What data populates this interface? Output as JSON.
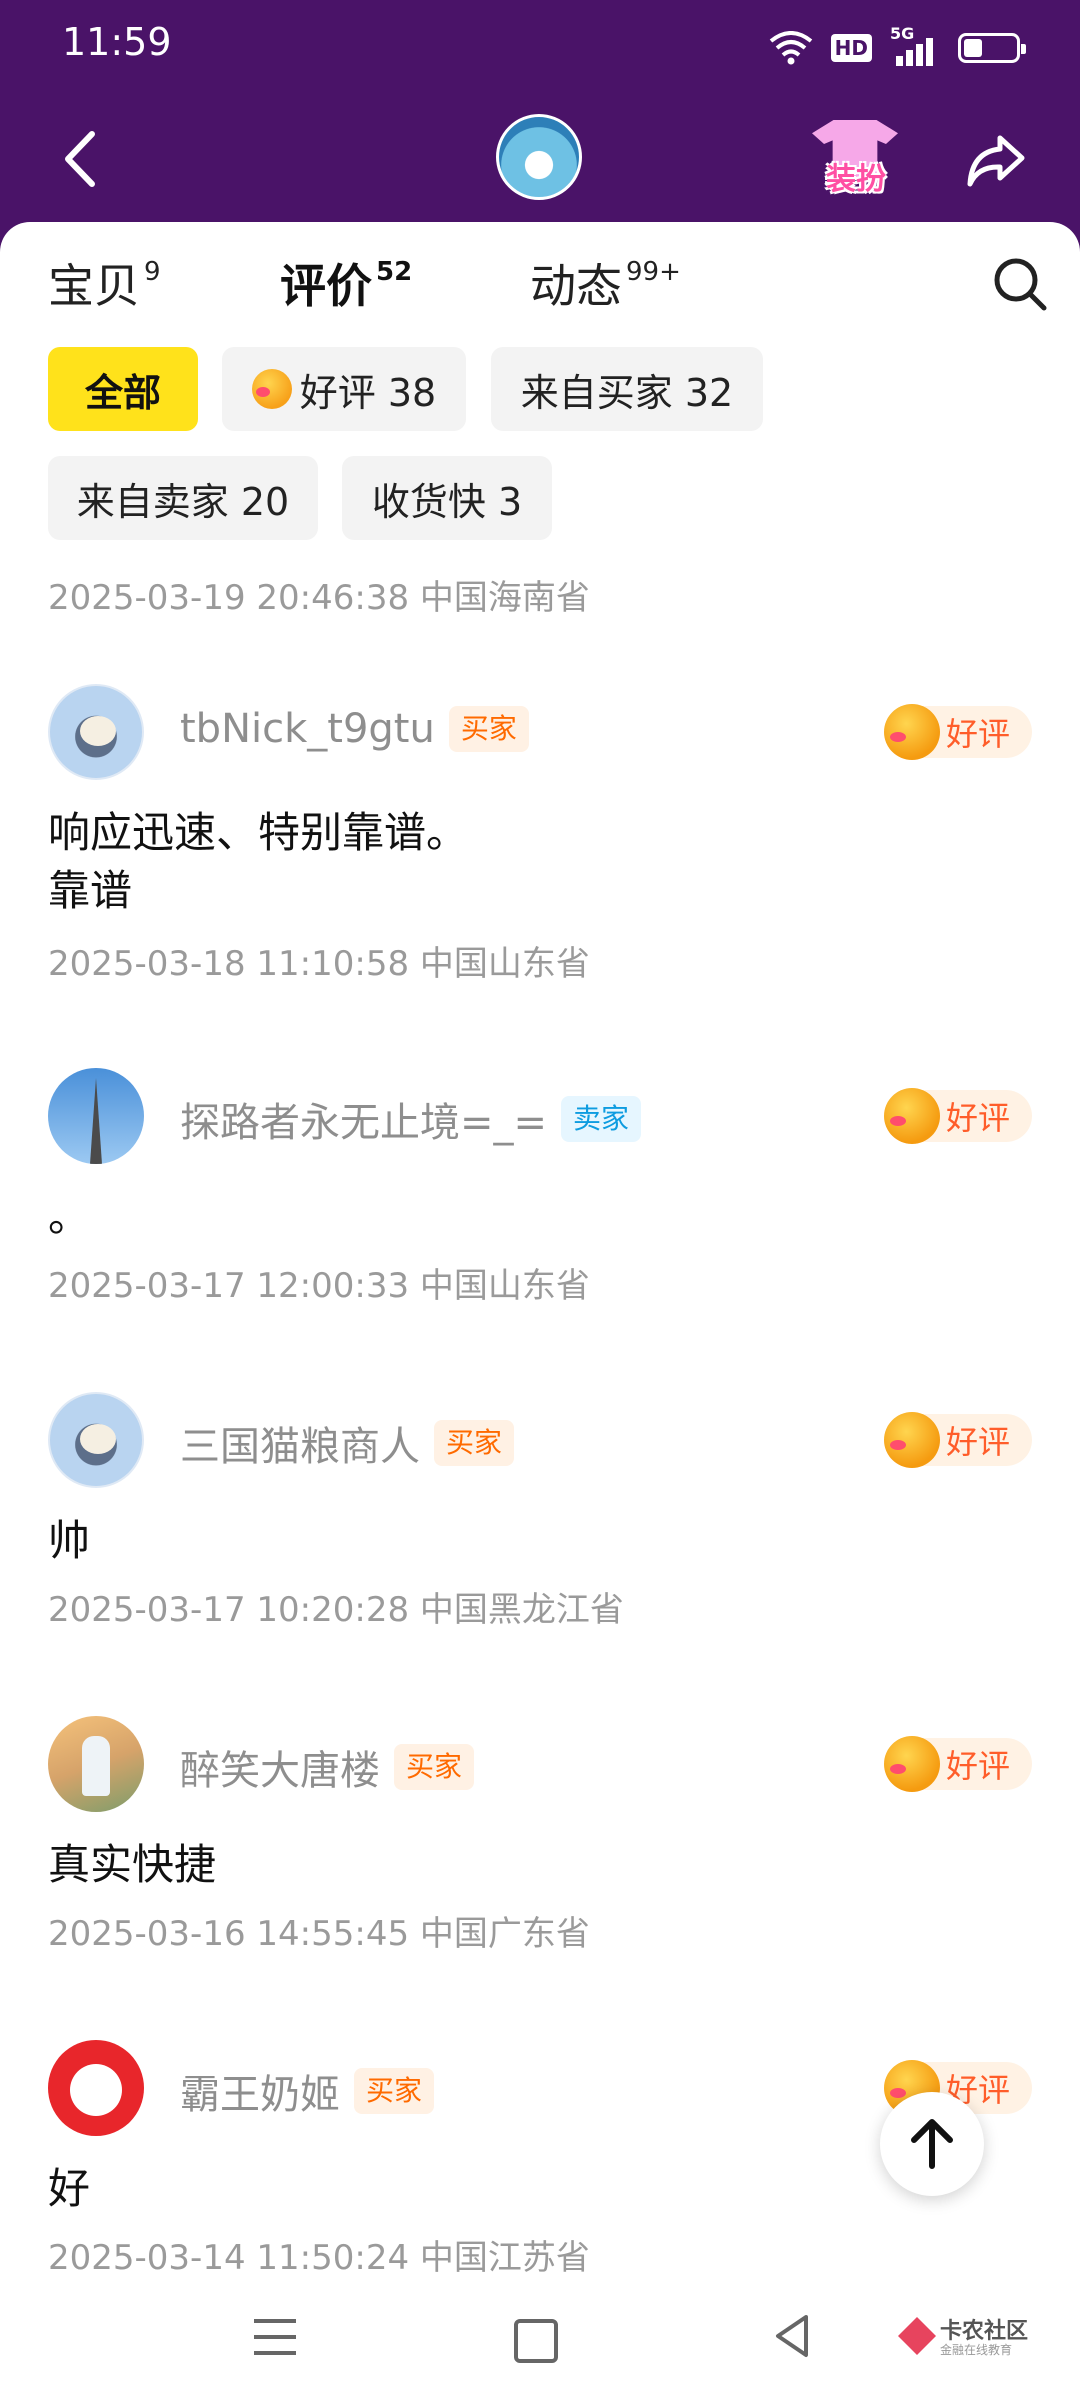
{
  "status_bar": {
    "time": "11:59",
    "hd": "HD",
    "network": "5G",
    "battery_level": 0.35
  },
  "header": {
    "dress_label": "装扮"
  },
  "tabs": [
    {
      "label": "宝贝",
      "count": "9"
    },
    {
      "label": "评价",
      "count": "52"
    },
    {
      "label": "动态",
      "count": "99+"
    }
  ],
  "filters": [
    {
      "label": "全部"
    },
    {
      "label": "好评 38"
    },
    {
      "label": "来自买家 32"
    },
    {
      "label": "来自卖家 20"
    },
    {
      "label": "收货快 3"
    }
  ],
  "first_meta": "2025-03-19 20:46:38 中国海南省",
  "reviews": [
    {
      "name": "tbNick_t9gtu",
      "role": "买家",
      "rating": "好评",
      "comment_line1": "响应迅速、特别靠谱。",
      "comment_line2": "靠谱",
      "meta": "2025-03-18 11:10:58 中国山东省"
    },
    {
      "name": "探路者永无止境=_=",
      "role": "卖家",
      "rating": "好评",
      "comment_line1": "。",
      "meta": "2025-03-17 12:00:33 中国山东省"
    },
    {
      "name": "三国猫粮商人",
      "role": "买家",
      "rating": "好评",
      "comment_line1": "帅",
      "meta": "2025-03-17 10:20:28 中国黑龙江省"
    },
    {
      "name": "醉笑大唐楼",
      "role": "买家",
      "rating": "好评",
      "comment_line1": "真实快捷",
      "meta": "2025-03-16 14:55:45 中国广东省"
    },
    {
      "name": "霸王奶姬",
      "role": "买家",
      "rating": "好评",
      "comment_line1": "好",
      "meta": "2025-03-14 11:50:24 中国江苏省"
    }
  ],
  "watermark": {
    "title": "卡农社区",
    "subtitle": "金融在线教育"
  },
  "colors": {
    "header_bg": "#4a1368",
    "accent_yellow": "#ffe21b",
    "rating_orange": "#ff5d2a",
    "buyer_orange": "#ff6a00",
    "seller_blue": "#0e9ce0"
  },
  "icons": {
    "back": "back-arrow-icon",
    "share": "share-icon",
    "search": "search-icon",
    "to_top": "arrow-up-icon"
  }
}
